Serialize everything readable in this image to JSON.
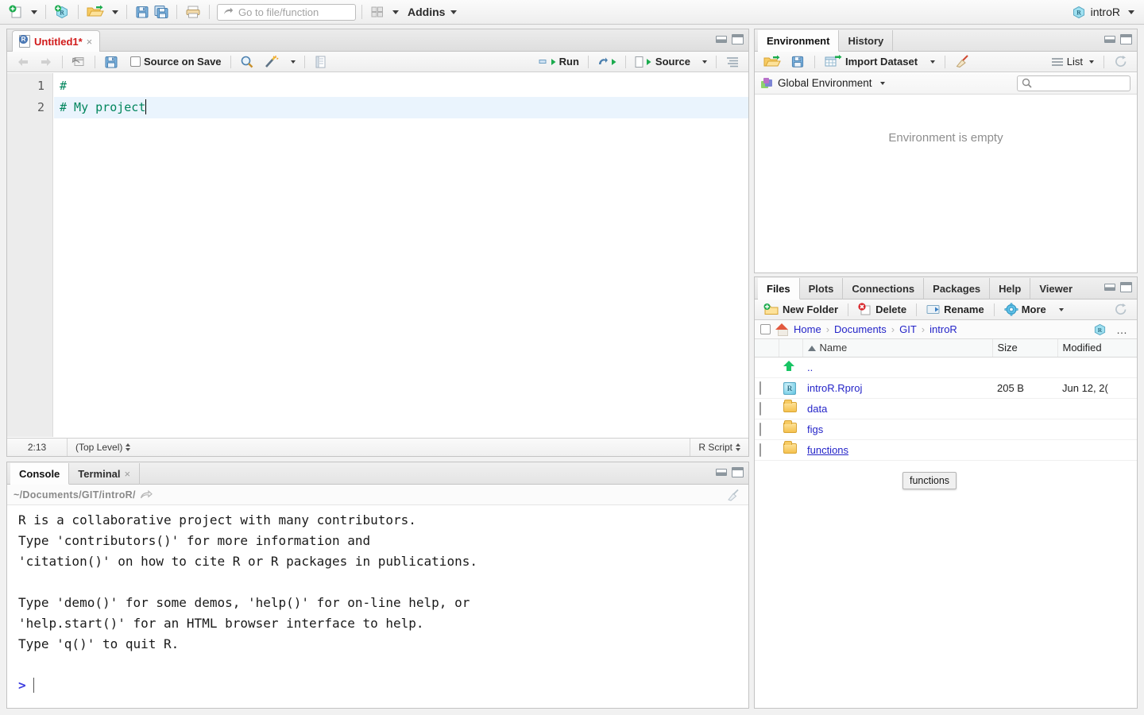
{
  "global_toolbar": {
    "buttons": [
      {
        "name": "new-file",
        "icon": "new-file-icon",
        "has_caret": true
      },
      {
        "name": "new-project",
        "icon": "new-project-icon",
        "has_caret": false
      },
      {
        "name": "open-file",
        "icon": "open-folder-icon",
        "has_caret": true
      },
      {
        "name": "save",
        "icon": "save-icon",
        "has_caret": false
      },
      {
        "name": "save-all",
        "icon": "save-all-icon",
        "has_caret": false
      },
      {
        "name": "print",
        "icon": "print-icon",
        "has_caret": false
      }
    ],
    "goto_placeholder": "Go to file/function",
    "addins_label": "Addins",
    "panes_icon": "panes-layout-icon",
    "project_name": "introR",
    "project_icon": "rproject-cube-icon"
  },
  "source": {
    "tab": {
      "title": "Untitled1*",
      "icon": "r-script-file-icon",
      "close": "×"
    },
    "toolbar": {
      "back": "back-arrow-icon",
      "forward": "forward-arrow-icon",
      "popout": "show-in-new-window-icon",
      "save": "save-icon",
      "source_on_save_label": "Source on Save",
      "find": "magnifier-icon",
      "magic_wand": "code-tools-icon",
      "compile_report": "compile-report-icon",
      "run_label": "Run",
      "rerun": "rerun-icon",
      "source_label": "Source",
      "outline": "document-outline-icon"
    },
    "lines": [
      {
        "number": "1",
        "text": "#",
        "current": false
      },
      {
        "number": "2",
        "text": "# My project",
        "current": true
      }
    ],
    "status": {
      "cursor_position": "2:13",
      "scope": "(Top Level)",
      "file_type": "R Script"
    }
  },
  "console": {
    "tabs": [
      {
        "label": "Console",
        "active": true,
        "closable": false
      },
      {
        "label": "Terminal",
        "active": false,
        "closable": true,
        "close": "×"
      }
    ],
    "working_directory": "~/Documents/GIT/introR/",
    "popout_icon": "open-in-window-icon",
    "clear_icon": "broom-clear-icon",
    "output_lines": [
      "R is a collaborative project with many contributors.",
      "Type 'contributors()' for more information and",
      "'citation()' on how to cite R or R packages in publications.",
      "",
      "Type 'demo()' for some demos, 'help()' for on-line help, or",
      "'help.start()' for an HTML browser interface to help.",
      "Type 'q()' to quit R.",
      ""
    ],
    "prompt": ">"
  },
  "environment": {
    "tabs": [
      {
        "label": "Environment",
        "active": true
      },
      {
        "label": "History",
        "active": false
      }
    ],
    "toolbar": {
      "load_workspace": "open-folder-icon",
      "save_workspace": "save-icon",
      "import_dataset_label": "Import Dataset",
      "clear_icon": "broom-clear-icon",
      "view_menu_label": "List",
      "view_menu_icon": "list-lines-icon",
      "refresh_icon": "refresh-icon"
    },
    "scope_selector": {
      "label": "Global Environment",
      "icon": "global-environment-icon"
    },
    "search_placeholder": "",
    "search_icon": "search-icon",
    "empty_message": "Environment is empty"
  },
  "files": {
    "tabs": [
      {
        "label": "Files",
        "active": true
      },
      {
        "label": "Plots",
        "active": false
      },
      {
        "label": "Connections",
        "active": false
      },
      {
        "label": "Packages",
        "active": false
      },
      {
        "label": "Help",
        "active": false
      },
      {
        "label": "Viewer",
        "active": false
      }
    ],
    "toolbar": {
      "new_folder_label": "New Folder",
      "new_folder_icon": "new-folder-icon",
      "delete_label": "Delete",
      "delete_icon": "delete-icon",
      "rename_label": "Rename",
      "rename_icon": "rename-icon",
      "more_label": "More",
      "more_icon": "gear-icon",
      "refresh_icon": "refresh-icon"
    },
    "breadcrumb": {
      "home_icon": "home-icon",
      "segments": [
        "Home",
        "Documents",
        "GIT",
        "introR"
      ],
      "separator": "›",
      "project_icon": "rproject-cube-icon",
      "overflow": "…"
    },
    "columns": [
      "",
      "",
      "Name",
      "Size",
      "Modified"
    ],
    "sort_column": "Name",
    "rows": [
      {
        "icon": "up-one-level-icon",
        "name": "..",
        "size": "",
        "modified": "",
        "checkbox": false,
        "hovered": false
      },
      {
        "icon": "rproject-file-icon",
        "name": "introR.Rproj",
        "size": "205 B",
        "modified": "Jun 12, 2(",
        "checkbox": true,
        "hovered": false
      },
      {
        "icon": "folder-icon",
        "name": "data",
        "size": "",
        "modified": "",
        "checkbox": true,
        "hovered": false
      },
      {
        "icon": "folder-icon",
        "name": "figs",
        "size": "",
        "modified": "",
        "checkbox": true,
        "hovered": false
      },
      {
        "icon": "folder-icon",
        "name": "functions",
        "size": "",
        "modified": "",
        "checkbox": true,
        "hovered": true
      }
    ],
    "tooltip": "functions"
  },
  "colors": {
    "comment_green": "#00855c",
    "link_blue": "#2424c8",
    "tab_red": "#d11a1a",
    "prompt_blue": "#3d3de0",
    "current_line": "#eaf4fd"
  }
}
